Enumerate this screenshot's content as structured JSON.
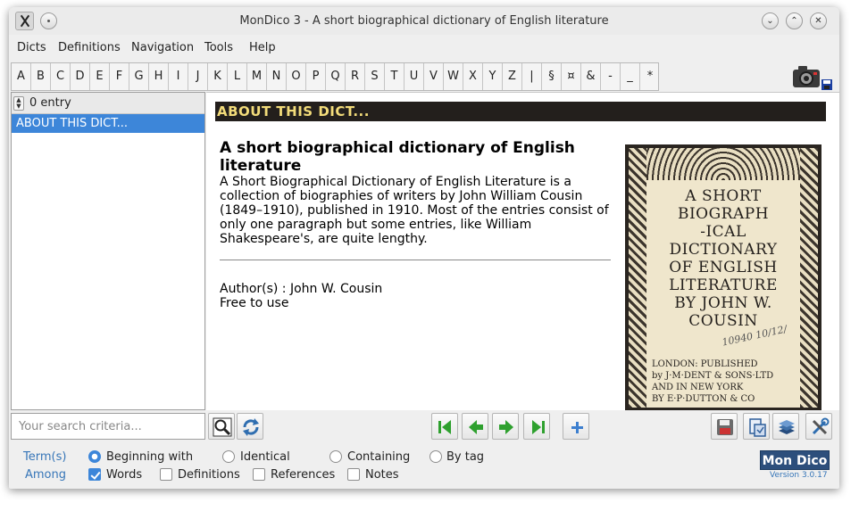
{
  "window": {
    "title": "MonDico 3 - A short biographical dictionary of English literature",
    "minimize_symbol": "⌄",
    "maximize_symbol": "⌃",
    "close_symbol": "✕"
  },
  "menu": [
    "Dicts",
    "Definitions",
    "Navigation",
    "Tools",
    "Help"
  ],
  "alphabet": [
    "A",
    "B",
    "C",
    "D",
    "E",
    "F",
    "G",
    "H",
    "I",
    "J",
    "K",
    "L",
    "M",
    "N",
    "O",
    "P",
    "Q",
    "R",
    "S",
    "T",
    "U",
    "V",
    "W",
    "X",
    "Y",
    "Z",
    "|",
    "§",
    "¤",
    "&",
    "-",
    "_",
    "*"
  ],
  "list": {
    "count_label": "0 entry",
    "spin_up": "▲",
    "spin_down": "▼",
    "items": [
      "ABOUT THIS DICT..."
    ]
  },
  "content": {
    "header": "ABOUT THIS DICT...",
    "title": "A short biographical dictionary of English literature",
    "description": "A Short Biographical Dictionary of English Literature is a collection of biographies of writers by John William Cousin (1849–1910), published in 1910. Most of the entries consist of only one paragraph but some entries, like William Shakespeare's, are quite lengthy.",
    "author": "Author(s) : John W. Cousin",
    "license": "Free to use",
    "cover": {
      "line1": "A SHORT",
      "line2": "BIOGRAPH",
      "line3": "-ICAL",
      "line4": "DICTIONARY",
      "line5": "OF ENGLISH",
      "line6": "LITERATURE",
      "line7": "BY JOHN W.",
      "line8": "COUSIN",
      "handwriting": "10940 10/12/",
      "pub1": "LONDON: PUBLISHED",
      "pub2": "by J·M·DENT & SONS·LTD",
      "pub3": "AND IN NEW YORK",
      "pub4": "BY E·P·DUTTON & CO"
    }
  },
  "search": {
    "placeholder": "Your search criteria..."
  },
  "options": {
    "terms_label": "Term(s)",
    "among_label": "Among",
    "match_modes": [
      {
        "label": "Beginning with",
        "checked": true
      },
      {
        "label": "Identical",
        "checked": false
      },
      {
        "label": "Containing",
        "checked": false
      },
      {
        "label": "By tag",
        "checked": false
      }
    ],
    "scopes": [
      {
        "label": "Words",
        "checked": true
      },
      {
        "label": "Definitions",
        "checked": false
      },
      {
        "label": "References",
        "checked": false
      },
      {
        "label": "Notes",
        "checked": false
      }
    ]
  },
  "branding": {
    "logo": "Mon Dico",
    "version": "Version 3.0.17"
  },
  "colors": {
    "selection": "#3d86d9",
    "header_bg": "#231f1c",
    "header_text": "#f3dc7a",
    "nav_arrow": "#2ea02e",
    "option_label": "#3776b8",
    "logo_bg": "#2d4f7c"
  }
}
